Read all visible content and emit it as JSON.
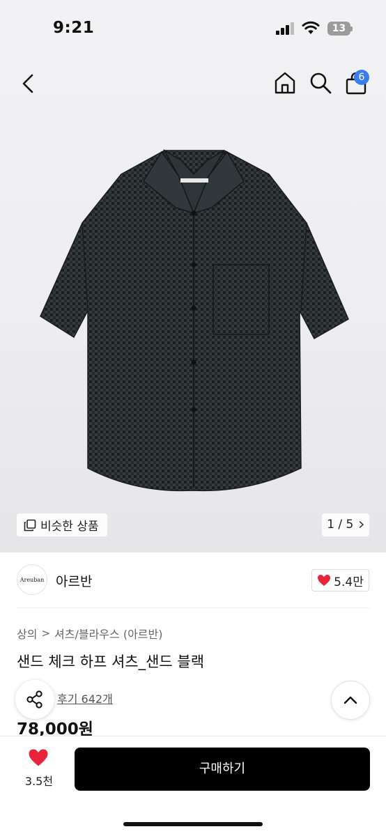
{
  "status_bar": {
    "time": "9:21",
    "battery": "13"
  },
  "nav": {
    "cart_count": "6"
  },
  "gallery": {
    "similar_label": "비슷한 상품",
    "counter": "1 / 5"
  },
  "brand": {
    "logo_text": "Areuban",
    "name": "아르반",
    "likes": "5.4만"
  },
  "product": {
    "breadcrumb": [
      "상의",
      "셔츠/블라우스 (아르반)"
    ],
    "title": "샌드 체크 하프 셔츠_샌드 블랙",
    "review": "후기 642개",
    "price": "78,000원"
  },
  "bottom_bar": {
    "wish_count": "3.5천",
    "buy_label": "구매하기"
  },
  "colors": {
    "accent_blue": "#3a7df0",
    "heart_red": "#e8243a",
    "buy_button": "#000000"
  },
  "icons": [
    "back-icon",
    "home-icon",
    "search-icon",
    "bag-icon",
    "copy-icon",
    "heart-icon",
    "share-icon",
    "chevron-up-icon",
    "chevron-right-icon"
  ]
}
